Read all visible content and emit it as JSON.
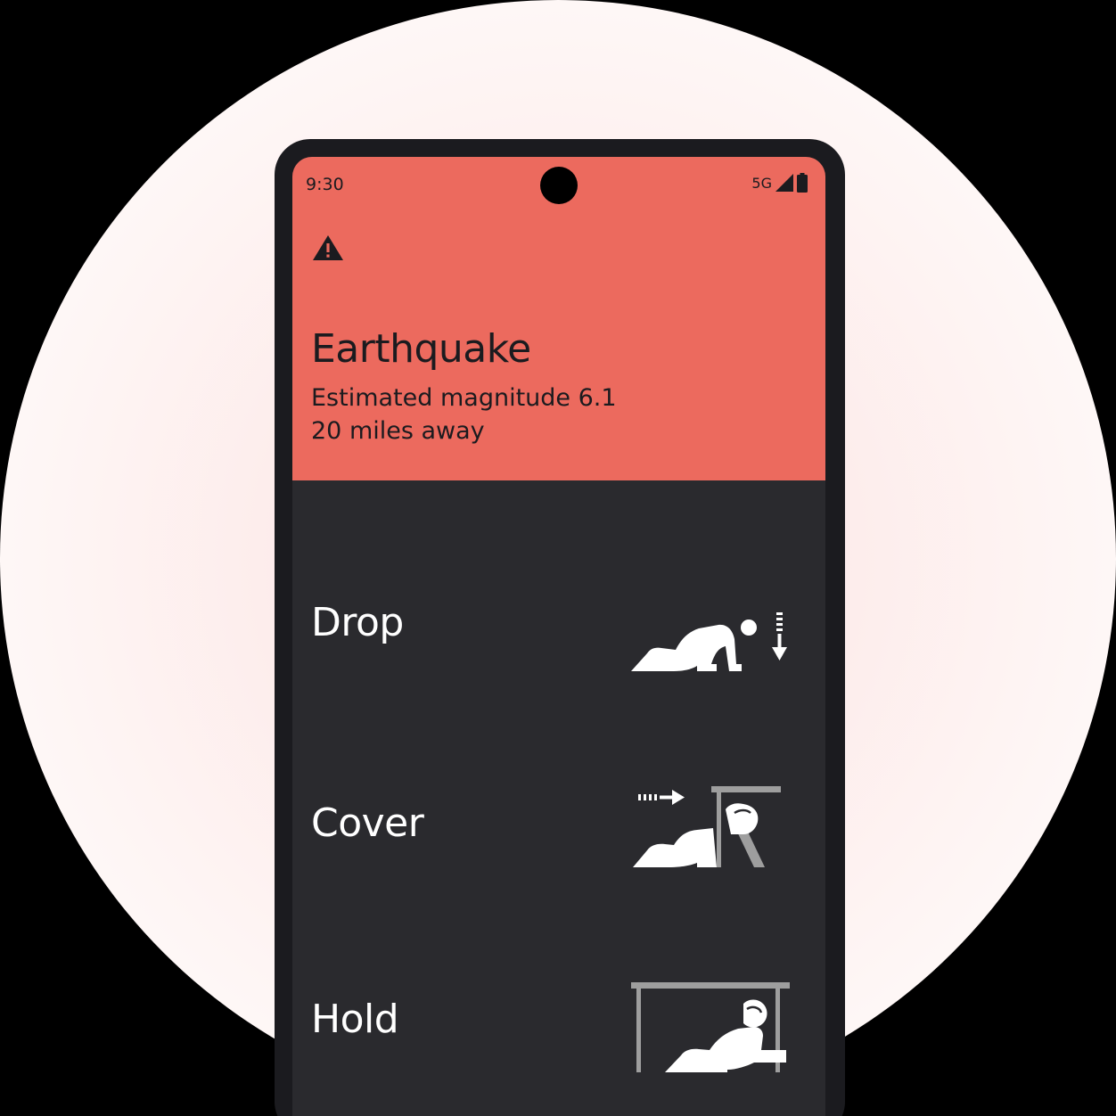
{
  "status_bar": {
    "time": "9:30",
    "network": "5G"
  },
  "alert": {
    "icon": "warning-icon",
    "title": "Earthquake",
    "magnitude_text": "Estimated magnitude 6.1",
    "distance_text": "20 miles away"
  },
  "steps": [
    {
      "label": "Drop",
      "icon": "drop-illustration"
    },
    {
      "label": "Cover",
      "icon": "cover-illustration"
    },
    {
      "label": "Hold",
      "icon": "hold-illustration"
    }
  ],
  "colors": {
    "alert_background": "#ec6a5e",
    "screen_background": "#2a2a2e",
    "phone_frame": "#1b1b1f",
    "text_light": "#ffffff",
    "text_dark": "#1b1b1f",
    "illustration_gray": "#9e9e9e"
  }
}
